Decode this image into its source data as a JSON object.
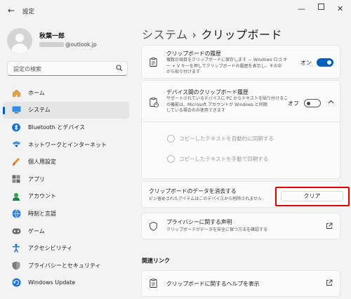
{
  "window": {
    "title": "設定",
    "back_glyph": "←",
    "minimize_glyph": "—",
    "close_glyph": "✕"
  },
  "user": {
    "name": "秋葉一郎",
    "email_suffix": "@outlook.jp"
  },
  "search": {
    "placeholder": "設定の検索",
    "icon": "search-icon"
  },
  "sidebar": {
    "items": [
      {
        "label": "ホーム",
        "icon": "home-icon",
        "selected": false
      },
      {
        "label": "システム",
        "icon": "system-icon",
        "selected": true
      },
      {
        "label": "Bluetooth とデバイス",
        "icon": "bluetooth-icon",
        "selected": false
      },
      {
        "label": "ネットワークとインターネット",
        "icon": "network-icon",
        "selected": false
      },
      {
        "label": "個人用設定",
        "icon": "personalization-icon",
        "selected": false
      },
      {
        "label": "アプリ",
        "icon": "apps-icon",
        "selected": false
      },
      {
        "label": "アカウント",
        "icon": "accounts-icon",
        "selected": false
      },
      {
        "label": "時刻と言語",
        "icon": "time-language-icon",
        "selected": false
      },
      {
        "label": "ゲーム",
        "icon": "gaming-icon",
        "selected": false
      },
      {
        "label": "アクセシビリティ",
        "icon": "accessibility-icon",
        "selected": false
      },
      {
        "label": "プライバシーとセキュリティ",
        "icon": "privacy-icon",
        "selected": false
      },
      {
        "label": "Windows Update",
        "icon": "windows-update-icon",
        "selected": false
      }
    ]
  },
  "header": {
    "crumb": "システム",
    "separator": "›",
    "title": "クリップボード"
  },
  "history": {
    "title": "クリップボードの履歴",
    "desc_line1": "複数の項目をクリップボードに保存します — Windows ロゴ キ",
    "desc_line2": "ー + V キーを押してクリップボードの履歴を表示し、その中",
    "desc_line3": "から貼り付けます",
    "toggle_label": "オン",
    "toggle_on": true
  },
  "sync": {
    "title": "デバイス間のクリップボード履歴",
    "desc_line1": "サポートされているデバイスに PC からテキストを貼り付けるこ",
    "desc_line2": "の機能は、Microsoft アカウントが Windows と同期",
    "desc_line3": "している場合のみ使用できます",
    "toggle_label": "オフ",
    "toggle_on": false,
    "option_auto": "コピーしたテキストを自動的に同期する",
    "option_manual": "コピーしたテキストを手動で同期する"
  },
  "clear": {
    "title": "クリップボードのデータを消去する",
    "desc": "ピン留めされたアイテムはこのデバイスから削除されません",
    "button_label": "クリア",
    "highlight_color": "#e00000"
  },
  "privacy": {
    "title": "プライバシーに関する声明",
    "desc": "クリップボードがデータを安全に保つ方法を確認する"
  },
  "related": {
    "heading": "関連リンク",
    "help_label": "クリップボードに関するヘルプを表示"
  },
  "colors": {
    "accent": "#005fb8",
    "background": "#f3f3f3",
    "card": "#fbfbfb"
  }
}
